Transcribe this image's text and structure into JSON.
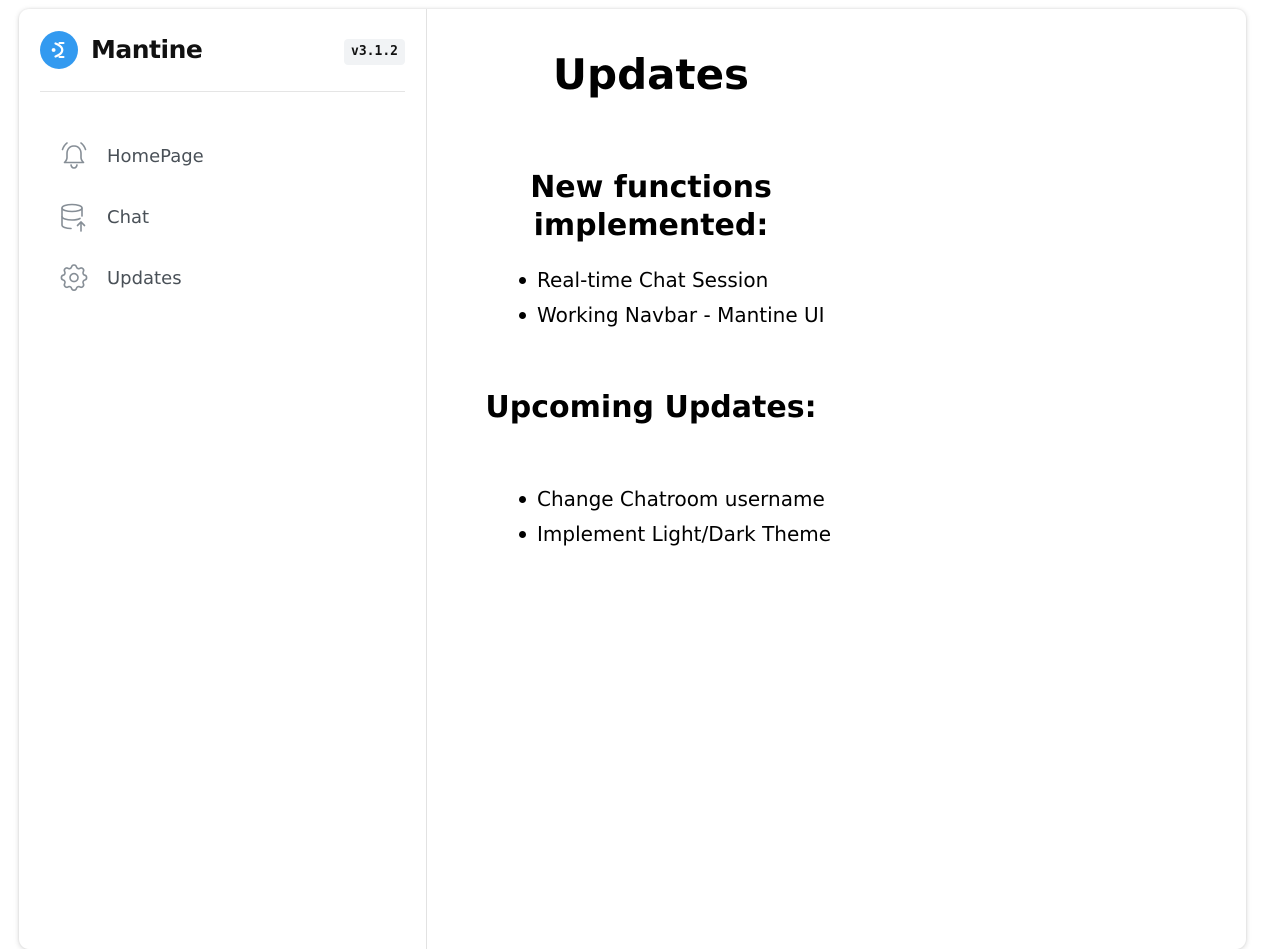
{
  "brand": {
    "name": "Mantine",
    "version": "v3.1.2",
    "accent_color": "#339af0",
    "logo_icon": "mantine-logo-icon"
  },
  "nav": {
    "items": [
      {
        "label": "HomePage",
        "icon": "bell-icon"
      },
      {
        "label": "Chat",
        "icon": "database-upload-icon"
      },
      {
        "label": "Updates",
        "icon": "gear-icon"
      }
    ]
  },
  "main": {
    "title": "Updates",
    "sections": [
      {
        "heading": "New functions implemented:",
        "items": [
          "Real-time Chat Session",
          "Working Navbar - Mantine UI"
        ]
      },
      {
        "heading": "Upcoming Updates:",
        "items": [
          "Change Chatroom username",
          "Implement Light/Dark Theme"
        ]
      }
    ]
  }
}
